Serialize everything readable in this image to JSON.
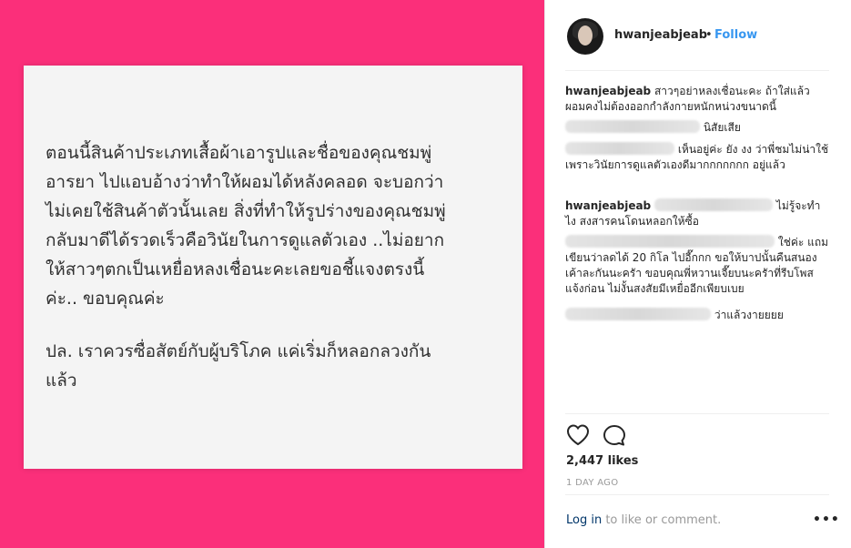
{
  "post": {
    "paragraph1": "ตอนนี้สินค้าประเภทเสื้อผ้าเอารูปและชื่อของคุณชมพู่\nอารยา ไปแอบอ้างว่าทำให้ผอมได้หลังคลอด จะบอกว่า\nไม่เคยใช้สินค้าตัวนั้นเลย สิ่งที่ทำให้รูปร่างของคุณชมพู่\nกลับมาดีได้รวดเร็วคือวินัยในการดูแลตัวเอง ..ไม่อยาก\nให้สาวๆตกเป็นเหยื่อหลงเชื่อนะคะเลยขอชี้แจงตรงนี้\nค่ะ.. ขอบคุณค่ะ",
    "paragraph2": "ปล. เราควรซื่อสัตย์กับผู้บริโภค แค่เริ่มก็หลอกลวงกัน\nแล้ว",
    "background_color": "#fb2f7a"
  },
  "header": {
    "username": "hwanjeabjeab",
    "separator": "•",
    "follow_label": "Follow"
  },
  "comments": [
    {
      "user": "hwanjeabjeab",
      "text": "สาวๆอย่าหลงเชื่อนะคะ ถ้าใส่แล้วผอมคงไม่ต้องออกกำลังกายหนักหน่วงขนาดนี้"
    },
    {
      "text": "นิสัยเสีย"
    },
    {
      "text": "เห็นอยู่ค่ะ ยัง งง ว่าพี่ชมไม่น่าใช้เพราะวินัยการดูแลตัวเองดีมากกกกกกก อยู่แล้ว"
    },
    {
      "user": "hwanjeabjeab",
      "text": "ไม่รู้จะทำไง สงสารคนโดนหลอกให้ซื้อ"
    },
    {
      "text": "ใช่ค่ะ แถมเขียนว่าลดได้ 20 กิโล ไปอี๊กกก ขอให้บาปนั้นคืนสนองเค้าละกันนะครัา ขอบคุณพี่หวานเจี๊ยบนะครัาที่รีบโพสแจ้งก่อน ไม่งั้นสงสัยมีเหยื่ออีกเพียบเบย"
    },
    {
      "text": "ว่าแล้วงายยยย"
    }
  ],
  "likes": "2,447 likes",
  "time_ago": "1 DAY AGO",
  "login": {
    "link_label": "Log in",
    "rest_label": " to like or comment."
  },
  "more_label": "•••",
  "icons": [
    "heart-icon",
    "comment-icon",
    "more-options-icon"
  ]
}
